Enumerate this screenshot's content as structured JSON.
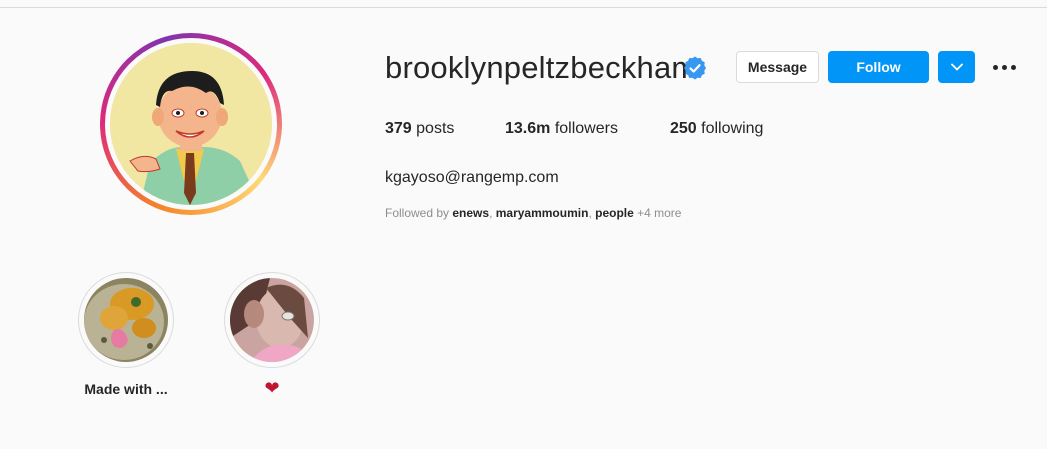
{
  "profile": {
    "username": "brooklynpeltzbeckham",
    "verified": true,
    "message_label": "Message",
    "follow_label": "Follow",
    "stats": {
      "posts_count": "379",
      "posts_label": "posts",
      "followers_count": "13.6m",
      "followers_label": "followers",
      "following_count": "250",
      "following_label": "following"
    },
    "bio": "kgayoso@rangemp.com",
    "followed_by": {
      "prefix": "Followed by",
      "names": [
        "enews",
        "maryammoumin",
        "people"
      ],
      "more": "+4 more"
    }
  },
  "highlights": [
    {
      "label": "Made with ..."
    },
    {
      "label": "❤"
    }
  ],
  "colors": {
    "accent": "#0095f6",
    "text": "#262626",
    "muted": "#8e8e8e",
    "background": "#fafafa"
  },
  "icons": [
    "verified-badge-icon",
    "chevron-down-icon",
    "more-options-icon"
  ]
}
